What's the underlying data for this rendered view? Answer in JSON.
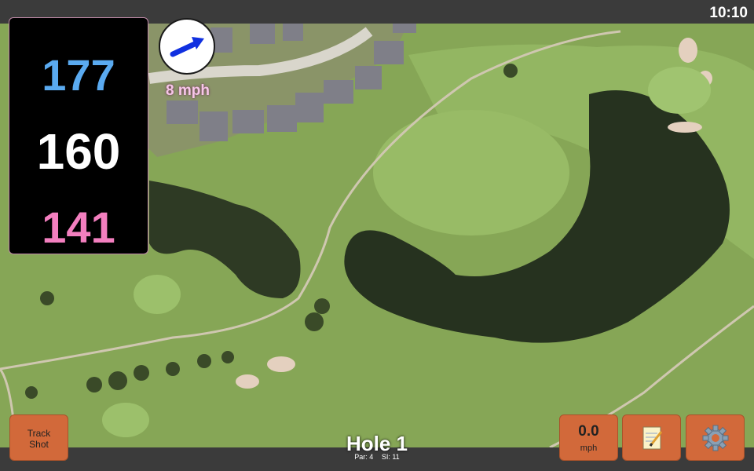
{
  "status": {
    "time": "10:10"
  },
  "distances": {
    "back": "177",
    "middle": "160",
    "front": "141",
    "back_color": "#5aaaf0",
    "front_color": "#f37fbf"
  },
  "wind": {
    "speed": "8 mph",
    "icon": "wind-arrow-icon",
    "arrow_color": "#1030e0"
  },
  "hole": {
    "title": "Hole 1",
    "par": "Par: 4",
    "si": "SI: 11"
  },
  "buttons": {
    "track_line1": "Track",
    "track_line2": "Shot",
    "speed_value": "0.0",
    "speed_unit": "mph",
    "notes_icon": "notepad-icon",
    "settings_icon": "gear-icon"
  }
}
